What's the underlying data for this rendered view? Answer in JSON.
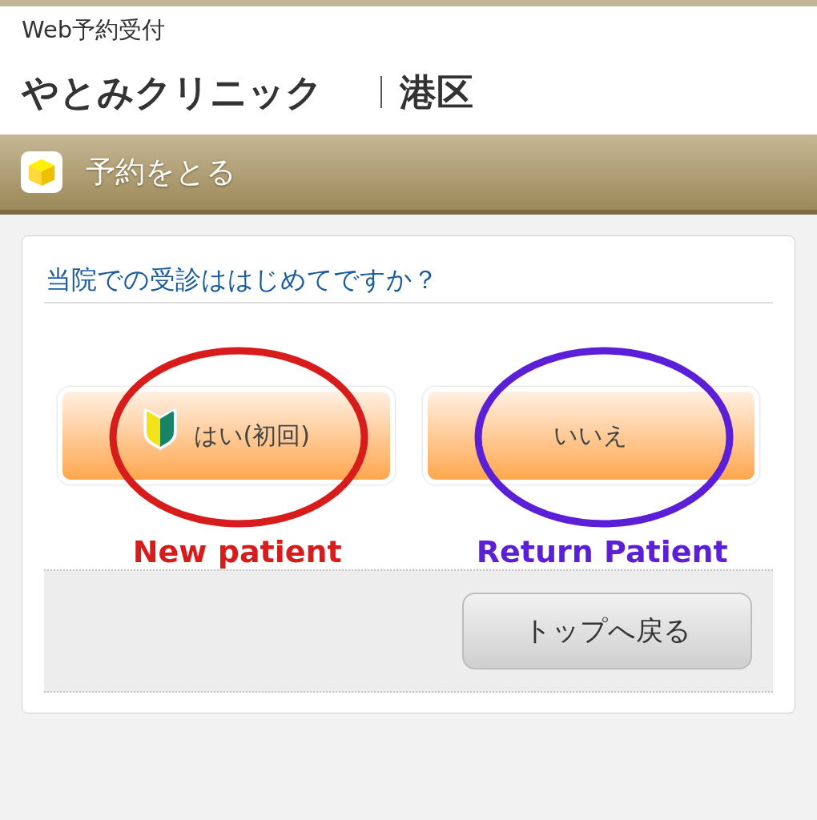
{
  "header": {
    "subtitle": "Web予約受付",
    "clinic_name": "やとみクリニック",
    "district": "港区"
  },
  "section": {
    "title": "予約をとる"
  },
  "question": {
    "title": "当院での受診ははじめてですか？",
    "choices": [
      {
        "label": "はい(初回)",
        "kind": "first-visit",
        "annotation": {
          "text": "New patient",
          "color": "#d81c1c"
        }
      },
      {
        "label": "いいえ",
        "kind": "plain",
        "annotation": {
          "text": "Return Patient",
          "color": "#5a1fd6"
        }
      }
    ]
  },
  "footer": {
    "back_button": "トップへ戻る"
  }
}
